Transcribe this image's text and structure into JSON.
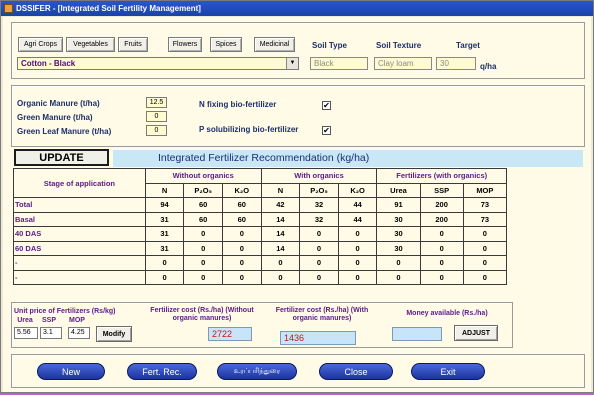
{
  "window": {
    "title": "DSSIFER - [Integrated Soil Fertility Management]"
  },
  "crops": [
    "Agri Crops",
    "Vegetables",
    "Fruits",
    "Flowers",
    "Spices",
    "Medicinal"
  ],
  "header": {
    "soil_type_label": "Soil Type",
    "soil_texture_label": "Soil Texture",
    "target_label": "Target",
    "crop_selected": "Cotton - Black",
    "soil_type_value": "Black",
    "soil_texture_value": "Clay loam",
    "target_value": "30",
    "target_unit": "q/ha"
  },
  "organics": {
    "organic_manure_label": "Organic Manure (t/ha)",
    "organic_manure_value": "12.5",
    "green_manure_label": "Green Manure (t/ha)",
    "green_manure_value": "0",
    "green_leaf_label": "Green Leaf Manure (t/ha)",
    "green_leaf_value": "0",
    "n_fixing_label": "N fixing bio-fertilizer",
    "n_fixing_checked": "✔",
    "p_solubilizing_label": "P solubilizing bio-fertilizer",
    "p_solubilizing_checked": "✔"
  },
  "update_label": "UPDATE",
  "recommendation_title": "Integrated Fertilizer Recommendation (kg/ha)",
  "table": {
    "stage_header": "Stage of application",
    "without_header": "Without organics",
    "with_header": "With organics",
    "fert_header": "Fertilizers (with organics)",
    "cols": [
      "N",
      "P₂O₅",
      "K₂O",
      "N",
      "P₂O₅",
      "K₂O",
      "Urea",
      "SSP",
      "MOP"
    ],
    "rows": [
      {
        "stage": "Total",
        "values": [
          "94",
          "60",
          "60",
          "42",
          "32",
          "44",
          "91",
          "200",
          "73"
        ]
      },
      {
        "stage": "Basal",
        "values": [
          "31",
          "60",
          "60",
          "14",
          "32",
          "44",
          "30",
          "200",
          "73"
        ]
      },
      {
        "stage": "40 DAS",
        "values": [
          "31",
          "0",
          "0",
          "14",
          "0",
          "0",
          "30",
          "0",
          "0"
        ]
      },
      {
        "stage": "60 DAS",
        "values": [
          "31",
          "0",
          "0",
          "14",
          "0",
          "0",
          "30",
          "0",
          "0"
        ]
      },
      {
        "stage": "-",
        "values": [
          "0",
          "0",
          "0",
          "0",
          "0",
          "0",
          "0",
          "0",
          "0"
        ]
      },
      {
        "stage": "-",
        "values": [
          "0",
          "0",
          "0",
          "0",
          "0",
          "0",
          "0",
          "0",
          "0"
        ]
      }
    ]
  },
  "prices": {
    "label": "Unit price of Fertilizers (Rs/kg)",
    "urea_label": "Urea",
    "ssp_label": "SSP",
    "mop_label": "MOP",
    "urea": "5.56",
    "ssp": "3.1",
    "mop": "4.25",
    "modify_label": "Modify"
  },
  "costs": {
    "without_label": "Fertilizer cost (Rs./ha) (Without organic manures)",
    "without_value": "2722",
    "with_label": "Fertilizer cost (Rs./ha) (With organic manures)",
    "with_value": "1436",
    "money_label": "Money available (Rs./ha)",
    "money_value": "",
    "adjust_label": "ADJUST"
  },
  "footer": {
    "new_label": "New",
    "fert_rec_label": "Fert. Rec.",
    "tamil_label": "உரப்பரிந்துரை",
    "close_label": "Close",
    "exit_label": "Exit"
  },
  "colors": {
    "title_bar": "#1b43a8",
    "label_blue": "#1b2f6b",
    "label_purple": "#5a1a8a",
    "cost_red": "#c01818"
  }
}
